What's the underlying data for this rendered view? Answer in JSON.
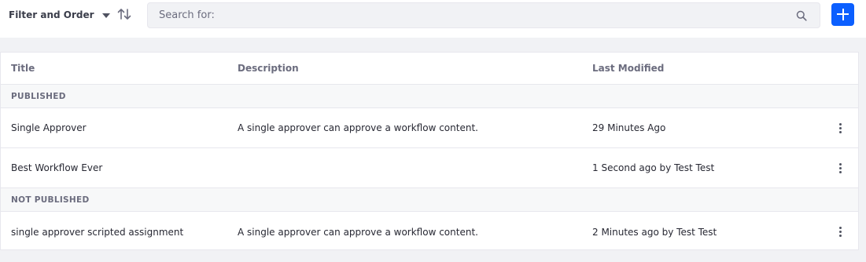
{
  "toolbar": {
    "filter_label": "Filter and Order",
    "search_placeholder": "Search for:"
  },
  "table": {
    "columns": [
      "Title",
      "Description",
      "Last Modified"
    ],
    "groups": [
      {
        "label": "PUBLISHED",
        "rows": [
          {
            "title": "Single Approver",
            "description": "A single approver can approve a workflow content.",
            "modified": "29 Minutes Ago"
          },
          {
            "title": "Best Workflow Ever",
            "description": "",
            "modified": "1 Second ago by Test Test"
          }
        ]
      },
      {
        "label": "NOT PUBLISHED",
        "rows": [
          {
            "title": "single approver scripted assignment",
            "description": "A single approver can approve a workflow content.",
            "modified": "2 Minutes ago by Test Test"
          }
        ]
      }
    ]
  },
  "colors": {
    "primary": "#0b5fff",
    "page_bg": "#f1f2f5",
    "border": "#e7e7ed"
  }
}
